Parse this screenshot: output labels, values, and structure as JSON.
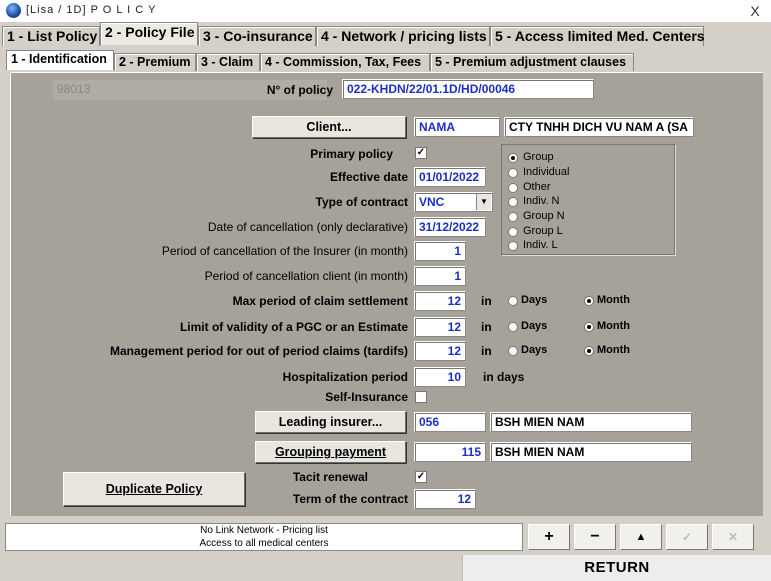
{
  "window": {
    "title": "[Lisa / 1D] P O L I C Y",
    "close": "X"
  },
  "tabs_main": [
    "1 - List Policy",
    "2 - Policy File",
    "3 - Co-insurance",
    "4 - Network / pricing lists",
    "5 - Access limited Med. Centers"
  ],
  "tabs_sub": [
    "1 - Identification",
    "2 - Premium",
    "3 - Claim",
    "4 - Commission, Tax, Fees",
    "5 - Premium adjustment clauses"
  ],
  "form": {
    "code": "98013",
    "policy_no_label": "N° of policy",
    "policy_no": "022-KHDN/22/01.1D/HD/00046",
    "client_button": "Client...",
    "client_code": "NAMA",
    "client_name": "CTY TNHH DICH VU NAM A (SA",
    "primary_policy_label": "Primary policy",
    "primary_policy_checked": "✓",
    "effective_date_label": "Effective date",
    "effective_date": "01/01/2022",
    "type_contract_label": "Type of contract",
    "type_contract": "VNC",
    "cancellation_date_label": "Date of cancellation (only declarative)",
    "cancellation_date": "31/12/2022",
    "cancel_insurer_label": "Period of cancellation of the Insurer (in month)",
    "cancel_insurer": "1",
    "cancel_client_label": "Period of cancellation client (in month)",
    "cancel_client": "1",
    "max_settlement_label": "Max period of claim settlement",
    "max_settlement": "12",
    "limit_validity_label": "Limit of validity of a PGC or an Estimate",
    "limit_validity": "12",
    "mgmt_period_label": "Management period for out of period claims (tardifs)",
    "mgmt_period": "12",
    "in_label": "in",
    "days_label": "Days",
    "month_label": "Month",
    "hosp_period_label": "Hospitalization period",
    "hosp_period": "10",
    "in_days_label": "in days",
    "self_insurance_label": "Self-Insurance",
    "leading_button": "Leading insurer...",
    "leading_code": "056",
    "leading_name": "BSH MIEN NAM",
    "grouping_button": "Grouping payment",
    "grouping_code": "115",
    "grouping_name": "BSH MIEN NAM",
    "tacit_renewal_label": "Tacit renewal",
    "tacit_renewal_checked": "✓",
    "term_label": "Term of the contract",
    "term": "12",
    "duplicate_button": "Duplicate Policy",
    "group_options": [
      "Group",
      "Individual",
      "Other",
      "Indiv. N",
      "Group N",
      "Group L",
      "Indiv. L"
    ],
    "group_selected": "Group"
  },
  "status": {
    "line1": "No Link Network - Pricing list",
    "line2": "Access to all medical centers"
  },
  "toolbar": {
    "add": "+",
    "remove": "−",
    "up": "▲",
    "ok": "✓",
    "cancel": "✕"
  },
  "return_button": "RETURN"
}
